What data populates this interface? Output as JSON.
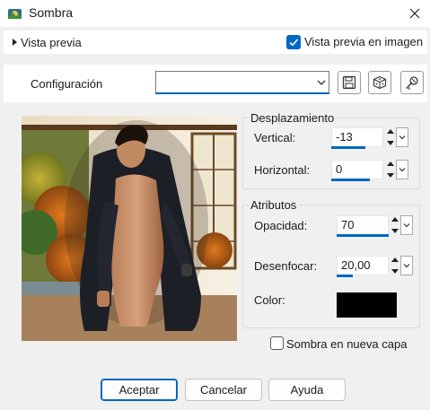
{
  "window": {
    "title": "Sombra",
    "icons": {
      "app": "app-logo-icon",
      "close": "close-icon"
    }
  },
  "preview": {
    "toggle_label": "Vista previa",
    "image_preview_label": "Vista previa en imagen",
    "image_preview_checked": true
  },
  "configuration": {
    "label": "Configuración",
    "value": "",
    "icons": {
      "save": "save-icon",
      "random": "dice-icon",
      "reset": "reset-icon"
    }
  },
  "displacement": {
    "title": "Desplazamiento",
    "vertical_label": "Vertical:",
    "vertical_value": "-13",
    "horizontal_label": "Horizontal:",
    "horizontal_value": "0"
  },
  "attributes": {
    "title": "Atributos",
    "opacity_label": "Opacidad:",
    "opacity_value": "70",
    "blur_label": "Desenfocar:",
    "blur_value": "20,00",
    "color_label": "Color:",
    "color_value": "#000000"
  },
  "new_layer": {
    "label": "Sombra en nueva capa",
    "checked": false
  },
  "buttons": {
    "ok": "Aceptar",
    "cancel": "Cancelar",
    "help": "Ayuda"
  },
  "colors": {
    "accent": "#0067c0",
    "dialog_bg": "#f0f0f0"
  }
}
